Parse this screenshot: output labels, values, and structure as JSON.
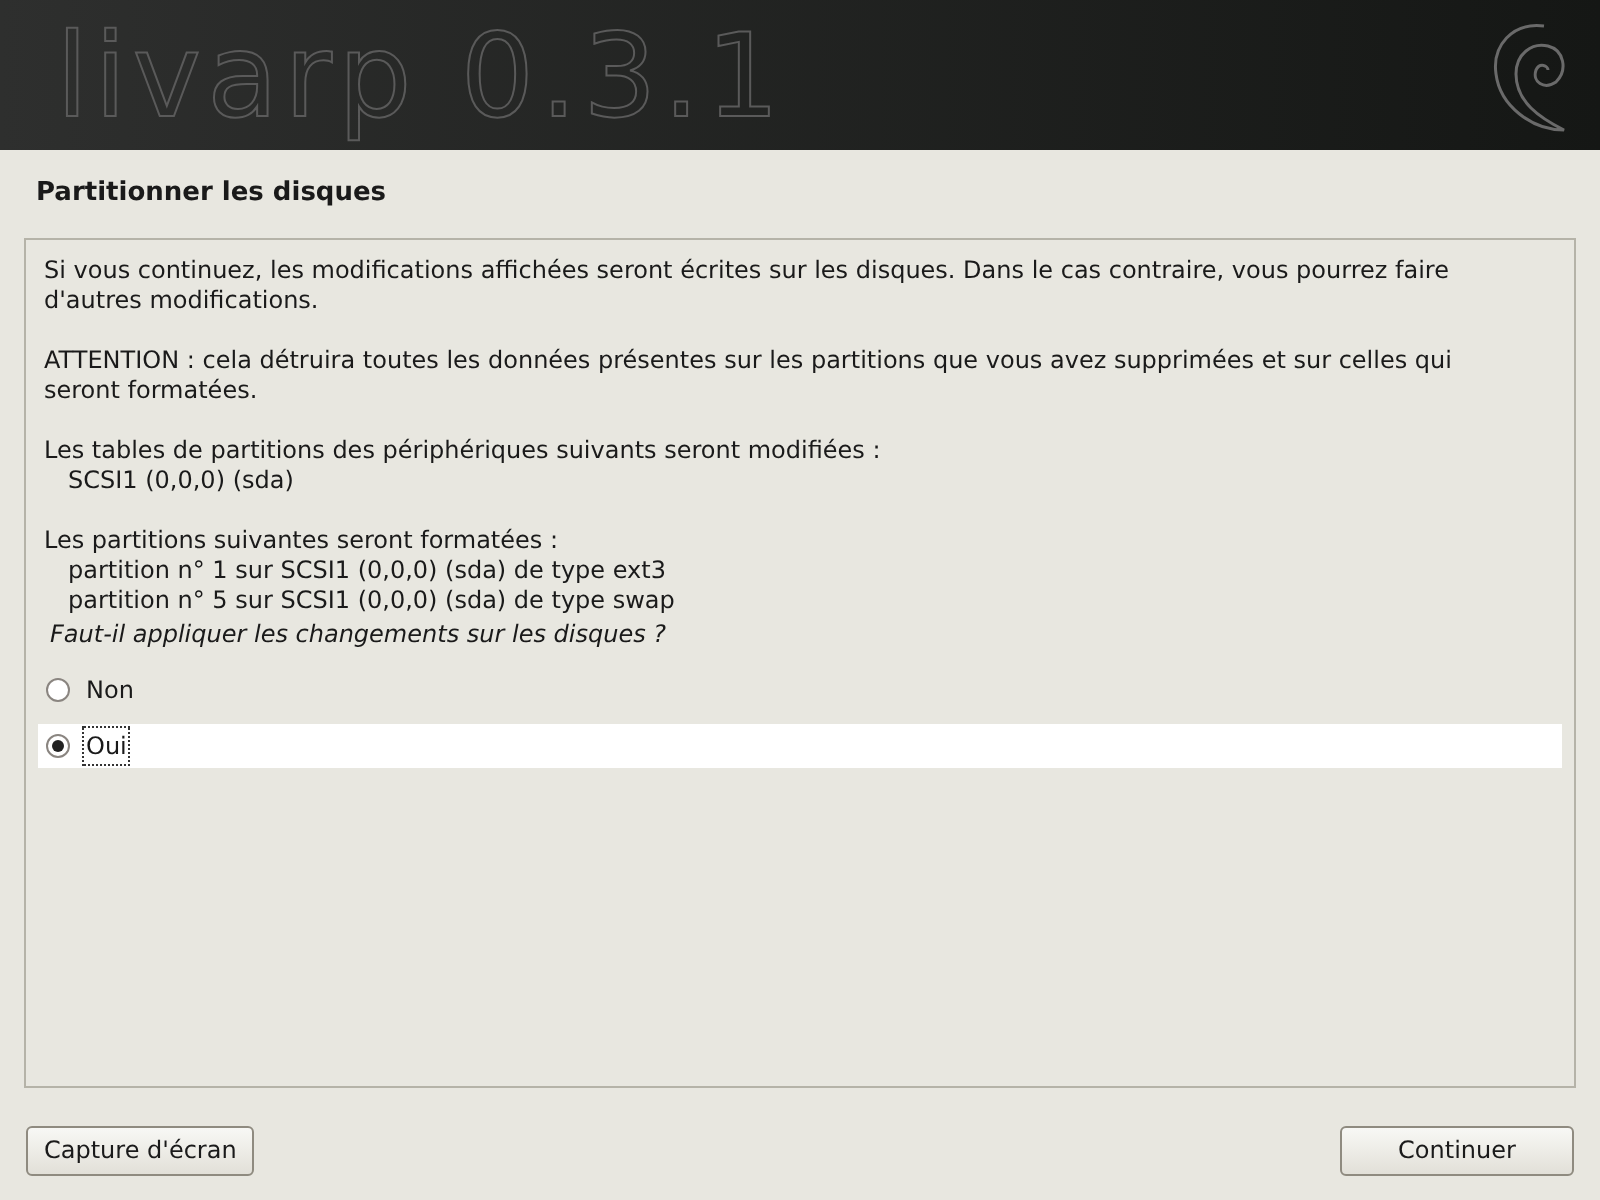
{
  "banner": {
    "logo_text": "livarp 0.3.1"
  },
  "title": "Partitionner les disques",
  "paragraphs": [
    {
      "text": "Si vous continuez, les modifications affichées seront écrites sur les disques. Dans le cas contraire, vous pourrez faire d'autres modifications."
    },
    {
      "text": "ATTENTION : cela détruira toutes les données présentes sur les partitions que vous avez supprimées et sur celles qui seront formatées."
    },
    {
      "text": "Les tables de partitions des périphériques suivants seront modifiées :",
      "items": [
        "SCSI1 (0,0,0) (sda)"
      ]
    },
    {
      "text": "Les partitions suivantes seront formatées :",
      "items": [
        "partition n° 1 sur SCSI1 (0,0,0) (sda) de type ext3",
        "partition n° 5 sur SCSI1 (0,0,0) (sda) de type swap"
      ]
    }
  ],
  "question": "Faut-il appliquer les changements sur les disques ?",
  "options": [
    {
      "label": "Non",
      "selected": false
    },
    {
      "label": "Oui",
      "selected": true
    }
  ],
  "buttons": {
    "left": "Capture d'écran",
    "right": "Continuer"
  }
}
